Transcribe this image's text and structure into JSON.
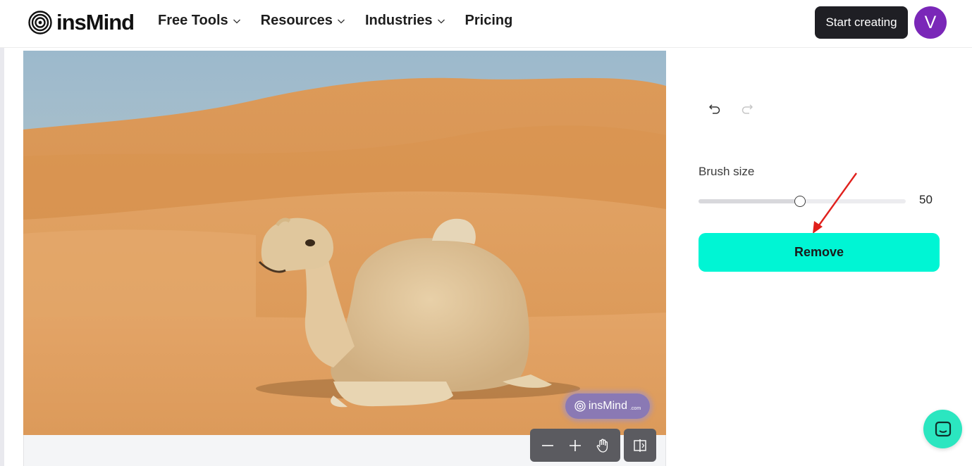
{
  "header": {
    "logo_text": "insMind",
    "nav": [
      {
        "label": "Free Tools",
        "has_dropdown": true
      },
      {
        "label": "Resources",
        "has_dropdown": true
      },
      {
        "label": "Industries",
        "has_dropdown": true
      },
      {
        "label": "Pricing",
        "has_dropdown": false
      }
    ],
    "start_button": "Start creating",
    "avatar_initial": "V"
  },
  "canvas": {
    "watermark_text": "insMind",
    "watermark_suffix": ".com",
    "tools": [
      "zoom-out-icon",
      "zoom-in-icon",
      "hand-icon",
      "compare-icon"
    ]
  },
  "panel": {
    "undo_icon": "undo-icon",
    "redo_icon": "redo-icon",
    "brush_label": "Brush size",
    "brush_value": "50",
    "brush_fraction": 0.49,
    "remove_label": "Remove"
  },
  "colors": {
    "accent": "#00f5d4",
    "avatar": "#7a27b8",
    "dark_button": "#1f1f24",
    "annotation_arrow": "#e0201c"
  }
}
